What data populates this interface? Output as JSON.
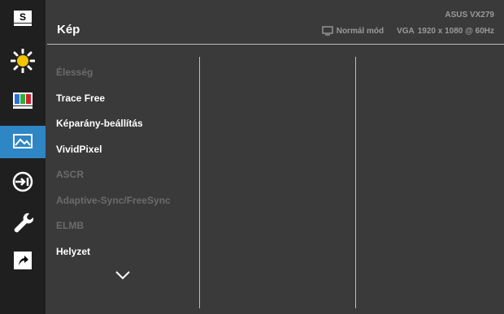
{
  "header": {
    "title": "Kép",
    "model": "ASUS VX279",
    "mode": "Normál mód",
    "input": "VGA",
    "resolution": "1920 x 1080 @ 60Hz"
  },
  "sidebar": {
    "items": [
      {
        "name": "splendid",
        "icon": "s-letter-icon",
        "label": "S",
        "active": false
      },
      {
        "name": "blue-light",
        "icon": "sun-icon",
        "active": false
      },
      {
        "name": "color",
        "icon": "color-bars-icon",
        "active": false
      },
      {
        "name": "image",
        "icon": "image-icon",
        "active": true
      },
      {
        "name": "input-select",
        "icon": "input-icon",
        "active": false
      },
      {
        "name": "system-setup",
        "icon": "wrench-icon",
        "active": false
      },
      {
        "name": "shortcut",
        "icon": "shortcut-arrow-icon",
        "active": false
      }
    ]
  },
  "menu": {
    "items": [
      {
        "label": "Élesség",
        "enabled": false
      },
      {
        "label": "Trace Free",
        "enabled": true
      },
      {
        "label": "Képarány-beállítás",
        "enabled": true
      },
      {
        "label": "VividPixel",
        "enabled": true
      },
      {
        "label": "ASCR",
        "enabled": false
      },
      {
        "label": "Adaptive-Sync/FreeSync",
        "enabled": false
      },
      {
        "label": "ELMB",
        "enabled": false
      },
      {
        "label": "Helyzet",
        "enabled": true
      }
    ],
    "scroll_icon": "chevron-down-icon"
  },
  "colors": {
    "background": "#3a3a3a",
    "sidebar": "#1f1f1f",
    "accent": "#2f86c5",
    "text": "#ffffff",
    "disabled_text": "#6b6b6b",
    "meta_text": "#9a9a9a"
  }
}
